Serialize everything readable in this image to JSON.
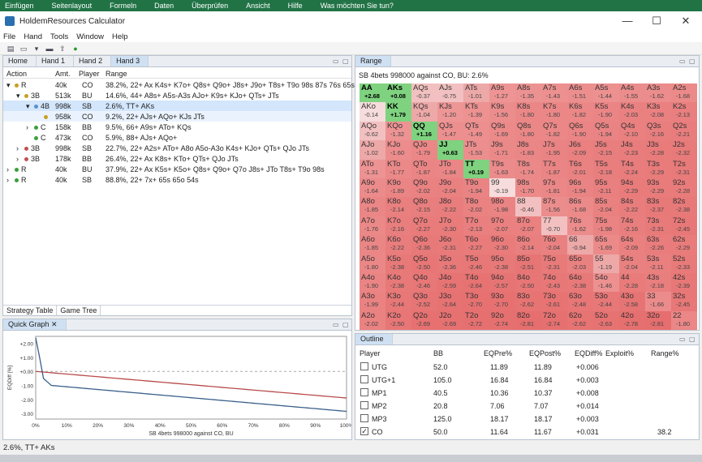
{
  "excel_menu": [
    "Einfügen",
    "Seitenlayout",
    "Formeln",
    "Daten",
    "Überprüfen",
    "Ansicht",
    "Hilfe",
    "Was möchten Sie tun?"
  ],
  "window": {
    "title": "HoldemResources Calculator",
    "min": "—",
    "max": "☐",
    "close": "✕"
  },
  "menu": [
    "File",
    "Hand",
    "Tools",
    "Window",
    "Help"
  ],
  "tabs": [
    "Home",
    "Hand 1",
    "Hand 2",
    "Hand 3"
  ],
  "strategy": {
    "columns": [
      "Action",
      "Amt.",
      "Player",
      "Range"
    ],
    "rows": [
      {
        "exp": "▾",
        "action": "R",
        "amt": "40k",
        "player": "CO",
        "range": "38.2%, 22+ Ax K4s+ K7o+ Q8s+ Q9o+ J8s+ J9o+ T8s+ T9o 98s 87s 76s 65s",
        "dot": "#c8a020",
        "cls": ""
      },
      {
        "exp": "▾",
        "action": "3B",
        "amt": "513k",
        "player": "BU",
        "range": "14.6%, 44+ A8s+ A5s-A3s AJo+ K9s+ KJo+ QTs+ JTs",
        "dot": "#c8a020",
        "cls": ""
      },
      {
        "exp": "▾",
        "action": "4B",
        "amt": "998k",
        "player": "SB",
        "range": "2.6%, TT+ AKs",
        "dot": "#5a90d0",
        "cls": "sel"
      },
      {
        "exp": "",
        "action": "",
        "amt": "958k",
        "player": "CO",
        "range": "9.2%, 22+ AJs+ AQo+ KJs JTs",
        "dot": "#c8a020",
        "cls": "sub"
      },
      {
        "exp": "›",
        "action": "C",
        "amt": "158k",
        "player": "BB",
        "range": "9.5%, 66+ A9s+ ATo+ KQs",
        "dot": "#3aa03a",
        "cls": ""
      },
      {
        "exp": "",
        "action": "C",
        "amt": "473k",
        "player": "CO",
        "range": "5.9%, 88+ AJs+ AQo+",
        "dot": "#3aa03a",
        "cls": ""
      },
      {
        "exp": "›",
        "action": "3B",
        "amt": "998k",
        "player": "SB",
        "range": "22.7%, 22+ A2s+ ATo+ A8o A5o-A3o K4s+ KJo+ QTs+ QJo JTs",
        "dot": "#c05050",
        "cls": ""
      },
      {
        "exp": "›",
        "action": "3B",
        "amt": "178k",
        "player": "BB",
        "range": "26.4%, 22+ Ax K8s+ KTo+ QTs+ QJo JTs",
        "dot": "#c05050",
        "cls": ""
      },
      {
        "exp": "›",
        "action": "R",
        "amt": "40k",
        "player": "BU",
        "range": "37.9%, 22+ Ax K5s+ K5o+ Q8s+ Q9o+ Q7o J8s+ JTo T8s+ T9o 98s",
        "dot": "#3aa03a",
        "cls": ""
      },
      {
        "exp": "›",
        "action": "R",
        "amt": "40k",
        "player": "SB",
        "range": "88.8%, 22+ 7x+ 65s 65o 54s",
        "dot": "#3aa03a",
        "cls": ""
      }
    ],
    "bottom_tabs": [
      "Strategy Table",
      "Game Tree"
    ]
  },
  "quick_graph": {
    "title": "Quick Graph",
    "ylabel": "EQDiff [%]",
    "xlabel": "SB 4bets 998000 against CO, BU",
    "yticks": [
      "+2.00",
      "+1.00",
      "+0.00",
      "-1.00",
      "-2.00",
      "-3.00"
    ],
    "xticks": [
      "0%",
      "10%",
      "20%",
      "30%",
      "40%",
      "50%",
      "60%",
      "70%",
      "80%",
      "90%",
      "100%"
    ],
    "series_colors": [
      "#b84a4a",
      "#3a5f8a"
    ]
  },
  "range": {
    "title": "Range",
    "header": "SB 4bets 998000 against CO, BU: 2.6%",
    "ranks": [
      "A",
      "K",
      "Q",
      "J",
      "T",
      "9",
      "8",
      "7",
      "6",
      "5",
      "4",
      "3",
      "2"
    ],
    "values": [
      [
        "+2.68",
        "+0.08",
        "-0.37",
        "-0.75",
        "-1.01",
        "-1.27",
        "-1.35",
        "-1.43",
        "-1.51",
        "-1.44",
        "-1.55",
        "-1.62",
        "-1.68"
      ],
      [
        "-0.14",
        "+1.79",
        "-1.04",
        "-1.20",
        "-1.39",
        "-1.56",
        "-1.80",
        "-1.80",
        "-1.82",
        "-1.90",
        "-2.03",
        "-2.08",
        "-2.13"
      ],
      [
        "-0.62",
        "-1.32",
        "+1.16",
        "-1.47",
        "-1.49",
        "-1.69",
        "-1.80",
        "-1.82",
        "-1.90",
        "-1.94",
        "-2.10",
        "-2.16",
        "-2.21"
      ],
      [
        "-1.02",
        "-1.60",
        "-1.79",
        "+0.63",
        "-1.53",
        "-1.71",
        "-1.83",
        "-1.95",
        "-2.09",
        "-2.15",
        "-2.23",
        "-2.28",
        "-2.32"
      ],
      [
        "-1.31",
        "-1.77",
        "-1.87",
        "-1.84",
        "+0.19",
        "-1.63",
        "-1.74",
        "-1.87",
        "-2.01",
        "-2.18",
        "-2.24",
        "-2.29",
        "-2.31"
      ],
      [
        "-1.64",
        "-1.89",
        "-2.02",
        "-2.04",
        "-1.94",
        "-0.19",
        "-1.70",
        "-1.81",
        "-1.94",
        "-2.11",
        "-2.29",
        "-2.29",
        "-2.28"
      ],
      [
        "-1.85",
        "-2.14",
        "-2.15",
        "-2.22",
        "-2.02",
        "-1.98",
        "-0.46",
        "-1.56",
        "-1.68",
        "-2.04",
        "-2.22",
        "-2.37",
        "-2.38"
      ],
      [
        "-1.76",
        "-2.16",
        "-2.27",
        "-2.30",
        "-2.13",
        "-2.07",
        "-2.07",
        "-0.70",
        "-1.62",
        "-1.98",
        "-2.16",
        "-2.31",
        "-2.45"
      ],
      [
        "-1.85",
        "-2.22",
        "-2.36",
        "-2.31",
        "-2.27",
        "-2.30",
        "-2.14",
        "-2.04",
        "-0.94",
        "-1.69",
        "-2.09",
        "-2.26",
        "-2.29"
      ],
      [
        "-1.80",
        "-2.38",
        "-2.50",
        "-2.36",
        "-2.46",
        "-2.38",
        "-2.51",
        "-2.31",
        "-2.03",
        "-1.19",
        "-2.04",
        "-2.11",
        "-2.33"
      ],
      [
        "-1.90",
        "-2.38",
        "-2.46",
        "-2.59",
        "-2.64",
        "-2.57",
        "-2.50",
        "-2.43",
        "-2.38",
        "-1.46",
        "-2.28",
        "-2.18",
        "-2.39"
      ],
      [
        "-1.99",
        "-2.44",
        "-2.52",
        "-2.64",
        "-2.70",
        "-2.70",
        "-2.62",
        "-2.61",
        "-2.48",
        "-2.44",
        "-2.58",
        "-1.66",
        "-2.45"
      ],
      [
        "-2.02",
        "-2.50",
        "-2.69",
        "-2.69",
        "-2.72",
        "-2.74",
        "-2.81",
        "-2.74",
        "-2.62",
        "-2.63",
        "-2.78",
        "-2.81",
        "-1.80"
      ]
    ]
  },
  "outline": {
    "title": "Outline",
    "columns": [
      "Player",
      "BB",
      "EQPre%",
      "EQPost%",
      "EQDiff%",
      "Exploit%",
      "Range%"
    ],
    "rows": [
      {
        "checked": "",
        "player": "UTG",
        "bb": "52.0",
        "pre": "11.89",
        "post": "11.89",
        "diff": "+0.006",
        "exploit": "",
        "range": ""
      },
      {
        "checked": "",
        "player": "UTG+1",
        "bb": "105.0",
        "pre": "16.84",
        "post": "16.84",
        "diff": "+0.003",
        "exploit": "",
        "range": ""
      },
      {
        "checked": "",
        "player": "MP1",
        "bb": "40.5",
        "pre": "10.36",
        "post": "10.37",
        "diff": "+0.008",
        "exploit": "",
        "range": ""
      },
      {
        "checked": "",
        "player": "MP2",
        "bb": "20.8",
        "pre": "7.06",
        "post": "7.07",
        "diff": "+0.014",
        "exploit": "",
        "range": ""
      },
      {
        "checked": "",
        "player": "MP3",
        "bb": "125.0",
        "pre": "18.17",
        "post": "18.17",
        "diff": "+0.003",
        "exploit": "",
        "range": ""
      },
      {
        "checked": "✓",
        "player": "CO",
        "bb": "50.0",
        "pre": "11.64",
        "post": "11.67",
        "diff": "+0.031",
        "exploit": "",
        "range": "38.2"
      }
    ]
  },
  "status": "2.6%, TT+ AKs"
}
